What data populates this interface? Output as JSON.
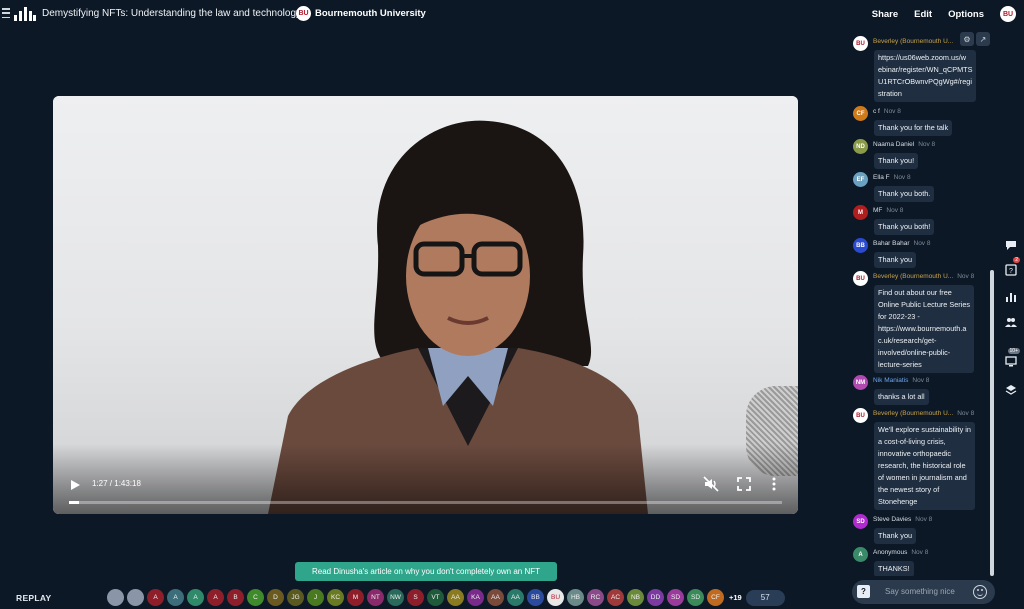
{
  "header": {
    "title": "Demystifying NFTs: Understanding the law and technology",
    "org_badge": "BU",
    "org_name": "Bournemouth University",
    "actions": [
      "Share",
      "Edit",
      "Options"
    ],
    "user_avatar": "BU"
  },
  "video": {
    "time": "1:27 / 1:43:18",
    "progress": 0.014,
    "muted": true
  },
  "footer": {
    "replay_label": "REPLAY",
    "banner": "Read Dinusha's article on why you don't completely own an NFT",
    "attendees": [
      {
        "initials": "",
        "color": "#8a96a8"
      },
      {
        "initials": "",
        "color": "#8a96a8"
      },
      {
        "initials": "A",
        "color": "#8e1f2a"
      },
      {
        "initials": "A",
        "color": "#3b6e7a"
      },
      {
        "initials": "A",
        "color": "#2f8a6a"
      },
      {
        "initials": "A",
        "color": "#8e1f2a"
      },
      {
        "initials": "B",
        "color": "#8e1f2a"
      },
      {
        "initials": "C",
        "color": "#3f8a2a"
      },
      {
        "initials": "D",
        "color": "#6b5a20"
      },
      {
        "initials": "JG",
        "color": "#5a5a20"
      },
      {
        "initials": "J",
        "color": "#4a7a20"
      },
      {
        "initials": "KC",
        "color": "#6a7a20"
      },
      {
        "initials": "M",
        "color": "#8e1f2a"
      },
      {
        "initials": "NT",
        "color": "#8a2a6a"
      },
      {
        "initials": "NW",
        "color": "#2a6a5a"
      },
      {
        "initials": "S",
        "color": "#8e1f2a"
      },
      {
        "initials": "VT",
        "color": "#1f5a3a"
      },
      {
        "initials": "AA",
        "color": "#8a7a20"
      },
      {
        "initials": "KA",
        "color": "#7a2a8a"
      },
      {
        "initials": "AA",
        "color": "#7a4a3a"
      },
      {
        "initials": "AA",
        "color": "#2a7a6a"
      },
      {
        "initials": "BB",
        "color": "#2a4aa0"
      },
      {
        "initials": "BU",
        "color": "#e8e8e8"
      },
      {
        "initials": "HB",
        "color": "#6a8a8a"
      },
      {
        "initials": "RC",
        "color": "#8a4a8a"
      },
      {
        "initials": "AC",
        "color": "#a03a3a"
      },
      {
        "initials": "NB",
        "color": "#6a8a3a"
      },
      {
        "initials": "DD",
        "color": "#7a3aa0"
      },
      {
        "initials": "SD",
        "color": "#9a3a9a"
      },
      {
        "initials": "SD",
        "color": "#3a8a5a"
      },
      {
        "initials": "CF",
        "color": "#c06a20"
      }
    ],
    "more": "+19",
    "count": "57"
  },
  "chat": {
    "placeholder": "Say something nice",
    "messages": [
      {
        "avatar": "BU",
        "avatar_color": "#ffffff",
        "name": "Beverley (Bournemouth U...",
        "host": true,
        "date": "",
        "lines": [
          "https://us06web.zoom.us/w",
          "ebinar/register/WN_qCPMTS",
          "U1RTCrOBwnvPQgWg#/regi",
          "stration"
        ]
      },
      {
        "avatar": "CF",
        "avatar_color": "#d07a1a",
        "name": "c f",
        "date": "Nov 8",
        "lines": [
          "Thank you for the talk"
        ]
      },
      {
        "avatar": "ND",
        "avatar_color": "#8a9a4a",
        "name": "Naama Daniel",
        "date": "Nov 8",
        "lines": [
          "Thank you!"
        ]
      },
      {
        "avatar": "EF",
        "avatar_color": "#6aa0c0",
        "name": "Ella F",
        "date": "Nov 8",
        "lines": [
          "Thank you both."
        ]
      },
      {
        "avatar": "M",
        "avatar_color": "#b01f1f",
        "name": "MF",
        "date": "Nov 8",
        "lines": [
          "Thank you both!"
        ]
      },
      {
        "avatar": "BB",
        "avatar_color": "#2a4ad0",
        "name": "Bahar Bahar",
        "date": "Nov 8",
        "lines": [
          "Thank you"
        ]
      },
      {
        "avatar": "BU",
        "avatar_color": "#ffffff",
        "name": "Beverley (Bournemouth U...",
        "host": true,
        "date": "Nov 8",
        "lines": [
          "Find out about our free",
          "Online Public Lecture Series",
          "for 2022-23 -",
          "https://www.bournemouth.a",
          "c.uk/research/get-",
          "involved/online-public-",
          "lecture-series"
        ]
      },
      {
        "avatar": "NM",
        "avatar_color": "#b04ab0",
        "name": "Nik Maniatis",
        "blue": true,
        "date": "Nov 8",
        "lines": [
          "thanks a lot all"
        ]
      },
      {
        "avatar": "BU",
        "avatar_color": "#ffffff",
        "name": "Beverley (Bournemouth U...",
        "host": true,
        "date": "Nov 8",
        "lines": [
          "We'll explore sustainability in",
          "a cost-of-living crisis,",
          "innovative orthopaedic",
          "research, the historical role",
          "of women in journalism and",
          "the newest story of",
          "Stonehenge"
        ]
      },
      {
        "avatar": "SD",
        "avatar_color": "#b02ad0",
        "name": "Steve Davies",
        "date": "Nov 8",
        "lines": [
          "Thank you"
        ]
      },
      {
        "avatar": "A",
        "avatar_color": "#3a8a6a",
        "name": "Anonymous",
        "date": "Nov 8",
        "lines": [
          "THANKS!"
        ]
      }
    ]
  },
  "rail": {
    "items": [
      {
        "icon": "chat-icon",
        "badge": ""
      },
      {
        "icon": "question-icon",
        "badge": "2"
      },
      {
        "icon": "poll-icon",
        "badge": ""
      },
      {
        "icon": "people-icon",
        "badge": ""
      },
      {
        "icon": "screen-icon",
        "badge": "10+"
      },
      {
        "icon": "layers-icon",
        "badge": ""
      }
    ]
  }
}
